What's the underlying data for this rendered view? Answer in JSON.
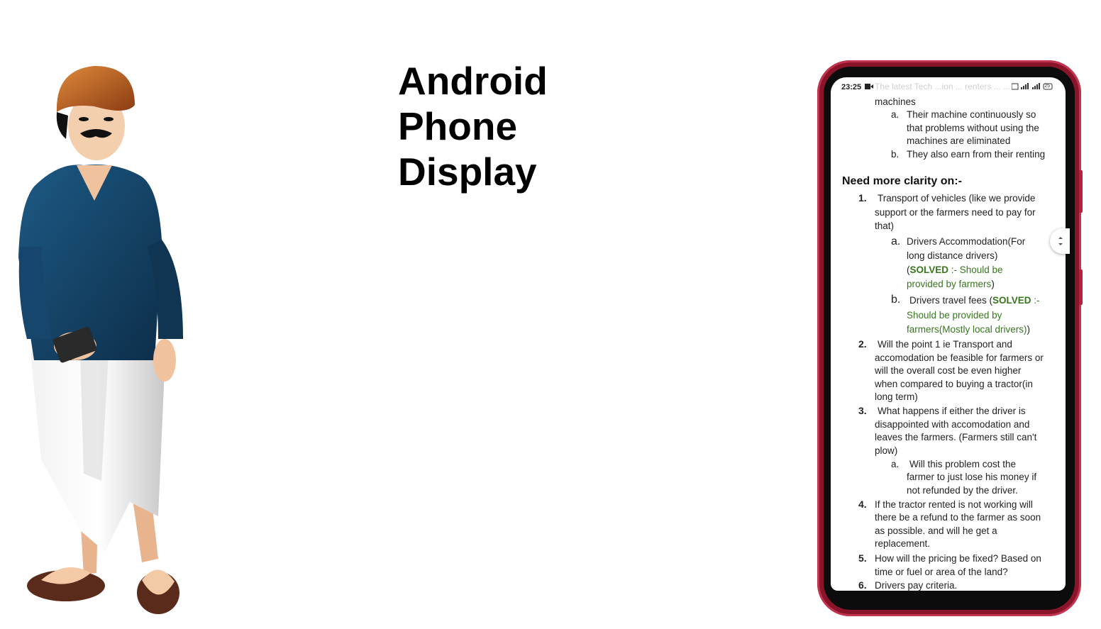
{
  "title": {
    "line1": "Android",
    "line2": "Phone",
    "line3": "Display"
  },
  "status_bar": {
    "time": "23:25",
    "camera_icon": "video-icon",
    "battery": "25"
  },
  "doc": {
    "ghost": "The latest Tech ...ion ... renters ... ...",
    "top": [
      "machines",
      "a.",
      "Their machine continuously so",
      "that problems without using the",
      "machines are eliminated",
      "b.",
      "They also earn from their renting"
    ],
    "heading": "Need more clarity on:-",
    "items": [
      {
        "num": "1.",
        "lines": [
          "Transport of vehicles (like we provide",
          "support or the farmers need to pay for",
          "that)"
        ]
      },
      {
        "num": "2.",
        "lines": [
          "Will the point 1 ie Transport and",
          "accomodation be feasible for farmers or",
          "will the overall cost be even higher",
          "when compared to buying a tractor(in",
          "long term)"
        ]
      },
      {
        "num": "3.",
        "lines": [
          "What happens if either the driver is",
          "disappointed with accomodation and",
          "leaves the farmers. (Farmers still can't",
          "plow)"
        ]
      },
      {
        "num": "4.",
        "lines": [
          "If the tractor rented is not working will",
          "there be a refund to the farmer as soon",
          "as possible. and will he get a",
          "replacement."
        ]
      },
      {
        "num": "5.",
        "lines": [
          "How will the pricing be fixed? Based on",
          "time or fuel or area of the land?"
        ]
      },
      {
        "num": "6.",
        "lines": [
          "Drivers pay criteria."
        ]
      }
    ],
    "sub1a": {
      "letter": "a.",
      "l1": "Drivers Accommodation(For",
      "l2": "long distance drivers)",
      "l3_open": "(",
      "l3_solved": "SOLVED",
      "l3_rest": " :- Should be",
      "l4": "provided by farmers",
      "l4_close": ")"
    },
    "sub1b": {
      "letter": "b.",
      "l1_pre": "Drivers travel fees (",
      "l1_solved": "SOLVED",
      "l1_rest": " :-",
      "l2": "Should be provided by",
      "l3": "farmers(Mostly local drivers)",
      "l3_close": ")"
    },
    "sub3a": {
      "letter": "a.",
      "lines": [
        "Will this problem cost the",
        "farmer to just lose his money if",
        "not refunded by the driver."
      ]
    }
  }
}
